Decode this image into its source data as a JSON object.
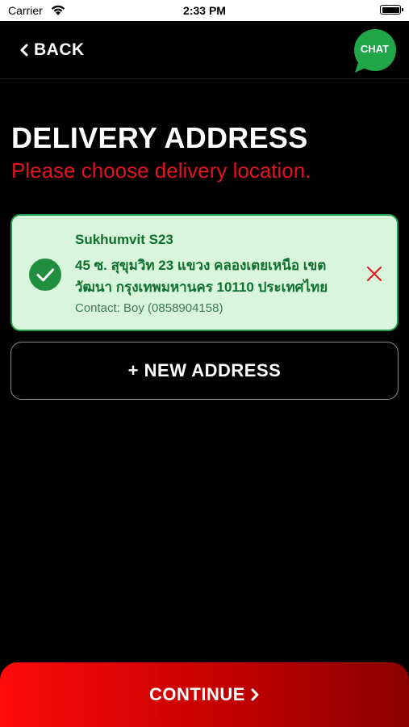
{
  "status_bar": {
    "carrier": "Carrier",
    "time": "2:33 PM"
  },
  "nav": {
    "back_label": "BACK",
    "chat_label": "CHAT"
  },
  "header": {
    "title": "DELIVERY ADDRESS",
    "subtitle": "Please choose delivery location."
  },
  "address": {
    "name": "Sukhumvit S23",
    "line": "45 ซ. สุขุมวิท 23 แขวง คลองเตยเหนือ เขต วัฒนา กรุงเทพมหานคร 10110 ประเทศไทย",
    "contact": "Contact: Boy (0858904158)",
    "selected": true
  },
  "new_address_label": "+ NEW ADDRESS",
  "continue_label": "CONTINUE",
  "colors": {
    "accent_red": "#e0141e",
    "selected_green": "#1f9c45",
    "card_bg": "#d9f5dc",
    "chat_green": "#21a649"
  },
  "icons": [
    "wifi-icon",
    "battery-icon",
    "chevron-left-icon",
    "chat-bubble-icon",
    "check-circle-icon",
    "close-icon",
    "chevron-right-icon"
  ]
}
